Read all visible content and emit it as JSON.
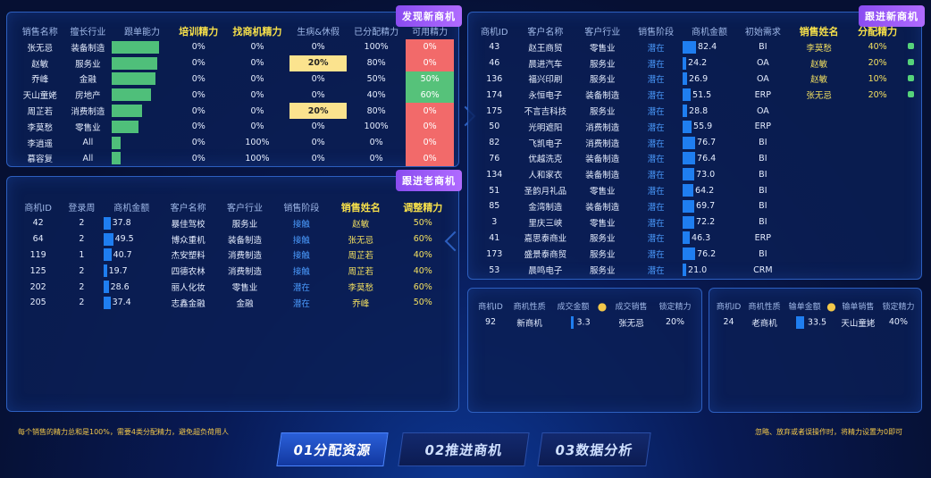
{
  "panel1": {
    "tag": "发现新商机",
    "headers": [
      "销售名称",
      "擅长行业",
      "跟单能力",
      "培训精力",
      "找商机精力",
      "生病&休假",
      "已分配精力",
      "可用精力"
    ],
    "rows": [
      {
        "name": "张无忌",
        "industry": "装备制造",
        "ability": 0.92,
        "train": "0%",
        "find": "0%",
        "sick": "0%",
        "assigned": "100%",
        "avail": "0%",
        "sick_hl": false,
        "avail_color": "red"
      },
      {
        "name": "赵敏",
        "industry": "服务业",
        "ability": 0.88,
        "train": "0%",
        "find": "0%",
        "sick": "20%",
        "assigned": "80%",
        "avail": "0%",
        "sick_hl": true,
        "avail_color": "red"
      },
      {
        "name": "乔峰",
        "industry": "金融",
        "ability": 0.85,
        "train": "0%",
        "find": "0%",
        "sick": "0%",
        "assigned": "50%",
        "avail": "50%",
        "sick_hl": false,
        "avail_color": "green"
      },
      {
        "name": "天山童姥",
        "industry": "房地产",
        "ability": 0.76,
        "train": "0%",
        "find": "0%",
        "sick": "0%",
        "assigned": "40%",
        "avail": "60%",
        "sick_hl": false,
        "avail_color": "green"
      },
      {
        "name": "周芷若",
        "industry": "消费制造",
        "ability": 0.58,
        "train": "0%",
        "find": "0%",
        "sick": "20%",
        "assigned": "80%",
        "avail": "0%",
        "sick_hl": true,
        "avail_color": "red"
      },
      {
        "name": "李莫愁",
        "industry": "零售业",
        "ability": 0.52,
        "train": "0%",
        "find": "0%",
        "sick": "0%",
        "assigned": "100%",
        "avail": "0%",
        "sick_hl": false,
        "avail_color": "red"
      },
      {
        "name": "李逍遥",
        "industry": "All",
        "ability": 0.18,
        "train": "0%",
        "find": "100%",
        "sick": "0%",
        "assigned": "0%",
        "avail": "0%",
        "sick_hl": false,
        "avail_color": "red"
      },
      {
        "name": "慕容复",
        "industry": "All",
        "ability": 0.18,
        "train": "0%",
        "find": "100%",
        "sick": "0%",
        "assigned": "0%",
        "avail": "0%",
        "sick_hl": false,
        "avail_color": "red"
      }
    ]
  },
  "panel2": {
    "tag": "跟进老商机",
    "headers": [
      "商机ID",
      "登录周",
      "商机金额",
      "客户名称",
      "客户行业",
      "销售阶段",
      "销售姓名",
      "调整精力"
    ],
    "rows": [
      {
        "id": "42",
        "week": "2",
        "amount": "37.8",
        "amt": 37.8,
        "client": "暴佳驾校",
        "industry": "服务业",
        "stage": "接触",
        "sales": "赵敏",
        "effort": "50%"
      },
      {
        "id": "64",
        "week": "2",
        "amount": "49.5",
        "amt": 49.5,
        "client": "博众重机",
        "industry": "装备制造",
        "stage": "接触",
        "sales": "张无忌",
        "effort": "60%"
      },
      {
        "id": "119",
        "week": "1",
        "amount": "40.7",
        "amt": 40.7,
        "client": "杰安塑料",
        "industry": "消费制造",
        "stage": "接触",
        "sales": "周芷若",
        "effort": "40%"
      },
      {
        "id": "125",
        "week": "2",
        "amount": "19.7",
        "amt": 19.7,
        "client": "四德农林",
        "industry": "消费制造",
        "stage": "接触",
        "sales": "周芷若",
        "effort": "40%"
      },
      {
        "id": "202",
        "week": "2",
        "amount": "28.6",
        "amt": 28.6,
        "client": "丽人化妆",
        "industry": "零售业",
        "stage": "潜在",
        "sales": "李莫愁",
        "effort": "60%"
      },
      {
        "id": "205",
        "week": "2",
        "amount": "37.4",
        "amt": 37.4,
        "client": "志鑫金融",
        "industry": "金融",
        "stage": "潜在",
        "sales": "乔峰",
        "effort": "50%"
      }
    ]
  },
  "panel3": {
    "tag": "跟进新商机",
    "headers": [
      "商机ID",
      "客户名称",
      "客户行业",
      "销售阶段",
      "商机金额",
      "初始需求",
      "销售姓名",
      "分配精力"
    ],
    "rows": [
      {
        "id": "43",
        "client": "赵王商贸",
        "industry": "零售业",
        "stage": "潜在",
        "amount": "82.4",
        "amt": 82.4,
        "need": "BI",
        "sales": "李莫愁",
        "effort": "40%",
        "check": true
      },
      {
        "id": "46",
        "client": "晨进汽车",
        "industry": "服务业",
        "stage": "潜在",
        "amount": "24.2",
        "amt": 24.2,
        "need": "OA",
        "sales": "赵敏",
        "effort": "20%",
        "check": true
      },
      {
        "id": "136",
        "client": "福兴印刷",
        "industry": "服务业",
        "stage": "潜在",
        "amount": "26.9",
        "amt": 26.9,
        "need": "OA",
        "sales": "赵敏",
        "effort": "10%",
        "check": true
      },
      {
        "id": "174",
        "client": "永恒电子",
        "industry": "装备制造",
        "stage": "潜在",
        "amount": "51.5",
        "amt": 51.5,
        "need": "ERP",
        "sales": "张无忌",
        "effort": "20%",
        "check": true
      },
      {
        "id": "175",
        "client": "不言吉科技",
        "industry": "服务业",
        "stage": "潜在",
        "amount": "28.8",
        "amt": 28.8,
        "need": "OA",
        "sales": "",
        "effort": "",
        "check": false
      },
      {
        "id": "50",
        "client": "光明遮阳",
        "industry": "消费制造",
        "stage": "潜在",
        "amount": "55.9",
        "amt": 55.9,
        "need": "ERP",
        "sales": "",
        "effort": "",
        "check": false
      },
      {
        "id": "82",
        "client": "飞凯电子",
        "industry": "消费制造",
        "stage": "潜在",
        "amount": "76.7",
        "amt": 76.7,
        "need": "BI",
        "sales": "",
        "effort": "",
        "check": false
      },
      {
        "id": "76",
        "client": "优越洗克",
        "industry": "装备制造",
        "stage": "潜在",
        "amount": "76.4",
        "amt": 76.4,
        "need": "BI",
        "sales": "",
        "effort": "",
        "check": false
      },
      {
        "id": "134",
        "client": "人和家衣",
        "industry": "装备制造",
        "stage": "潜在",
        "amount": "73.0",
        "amt": 73.0,
        "need": "BI",
        "sales": "",
        "effort": "",
        "check": false
      },
      {
        "id": "51",
        "client": "圣韵月礼品",
        "industry": "零售业",
        "stage": "潜在",
        "amount": "64.2",
        "amt": 64.2,
        "need": "BI",
        "sales": "",
        "effort": "",
        "check": false
      },
      {
        "id": "85",
        "client": "金湾制造",
        "industry": "装备制造",
        "stage": "潜在",
        "amount": "69.7",
        "amt": 69.7,
        "need": "BI",
        "sales": "",
        "effort": "",
        "check": false
      },
      {
        "id": "3",
        "client": "里庆三峡",
        "industry": "零售业",
        "stage": "潜在",
        "amount": "72.2",
        "amt": 72.2,
        "need": "BI",
        "sales": "",
        "effort": "",
        "check": false
      },
      {
        "id": "41",
        "client": "嘉思泰商业",
        "industry": "服务业",
        "stage": "潜在",
        "amount": "46.3",
        "amt": 46.3,
        "need": "ERP",
        "sales": "",
        "effort": "",
        "check": false
      },
      {
        "id": "173",
        "client": "盛景泰商贸",
        "industry": "服务业",
        "stage": "潜在",
        "amount": "76.2",
        "amt": 76.2,
        "need": "BI",
        "sales": "",
        "effort": "",
        "check": false
      },
      {
        "id": "53",
        "client": "晨鸣电子",
        "industry": "服务业",
        "stage": "潜在",
        "amount": "21.0",
        "amt": 21.0,
        "need": "CRM",
        "sales": "",
        "effort": "",
        "check": false
      }
    ]
  },
  "panel4": {
    "headers": [
      "商机ID",
      "商机性质",
      "成交金额",
      "成交销售",
      "锁定精力"
    ],
    "row": {
      "id": "92",
      "type": "新商机",
      "amount": "3.3",
      "sales": "张无忌",
      "effort": "20%"
    }
  },
  "panel5": {
    "headers": [
      "商机ID",
      "商机性质",
      "输单金额",
      "输单销售",
      "锁定精力"
    ],
    "row": {
      "id": "24",
      "type": "老商机",
      "amount": "33.5",
      "sales": "天山童姥",
      "effort": "40%"
    }
  },
  "footer": {
    "left_note": "每个销售的精力总和是100%，需要4类分配精力，避免超负荷用人",
    "right_note": "忽略、放弃或者误操作时，将精力设置为0即可",
    "tabs": [
      "01分配资源",
      "02推进商机",
      "03数据分析"
    ]
  },
  "colors": {
    "accent": "#b06bff",
    "bar_green": "#4fbf7a",
    "bar_blue": "#1f7ef0",
    "highlight": "#fbe38e",
    "red": "#f26a6a"
  }
}
